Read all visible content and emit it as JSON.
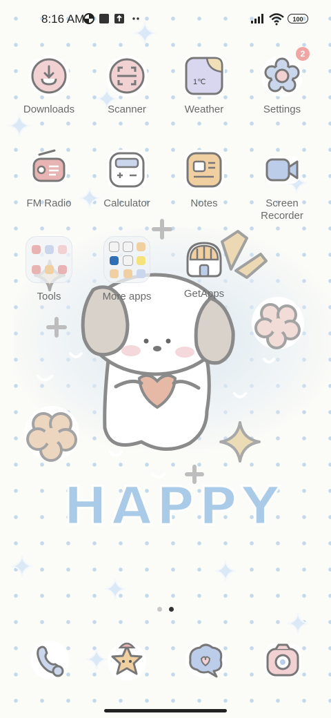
{
  "status_bar": {
    "time": "8:16 AM",
    "battery_level": "100",
    "icons": [
      "data-saver-icon",
      "stop-icon",
      "upload-icon",
      "more-dots-icon",
      "signal-icon",
      "wifi-icon",
      "battery-icon"
    ]
  },
  "apps": [
    {
      "label": "Downloads",
      "icon": "downloads-icon"
    },
    {
      "label": "Scanner",
      "icon": "scanner-icon"
    },
    {
      "label": "Weather",
      "icon": "weather-icon",
      "temp": "1℃"
    },
    {
      "label": "Settings",
      "icon": "settings-icon",
      "badge": "2"
    },
    {
      "label": "FM Radio",
      "icon": "radio-icon"
    },
    {
      "label": "Calculator",
      "icon": "calculator-icon"
    },
    {
      "label": "Notes",
      "icon": "notes-icon"
    },
    {
      "label": "Screen Recorder",
      "line1": "Screen",
      "line2": "Recorder",
      "icon": "screen-recorder-icon"
    },
    {
      "label": "Tools",
      "icon": "folder-icon"
    },
    {
      "label": "More apps",
      "icon": "folder-icon"
    },
    {
      "label": "GetApps",
      "icon": "getapps-icon"
    }
  ],
  "wallpaper": {
    "text": "HAPPY"
  },
  "pager": {
    "count": 2,
    "active": 1
  },
  "dock": [
    "phone-icon",
    "star-icon",
    "messages-icon",
    "camera-icon"
  ],
  "colors": {
    "background": "#fbfbf7",
    "dots": "#c5d9ec",
    "label": "#6a6a6a",
    "badge": "#f0a6a3",
    "happy": "#a9cbe8"
  }
}
